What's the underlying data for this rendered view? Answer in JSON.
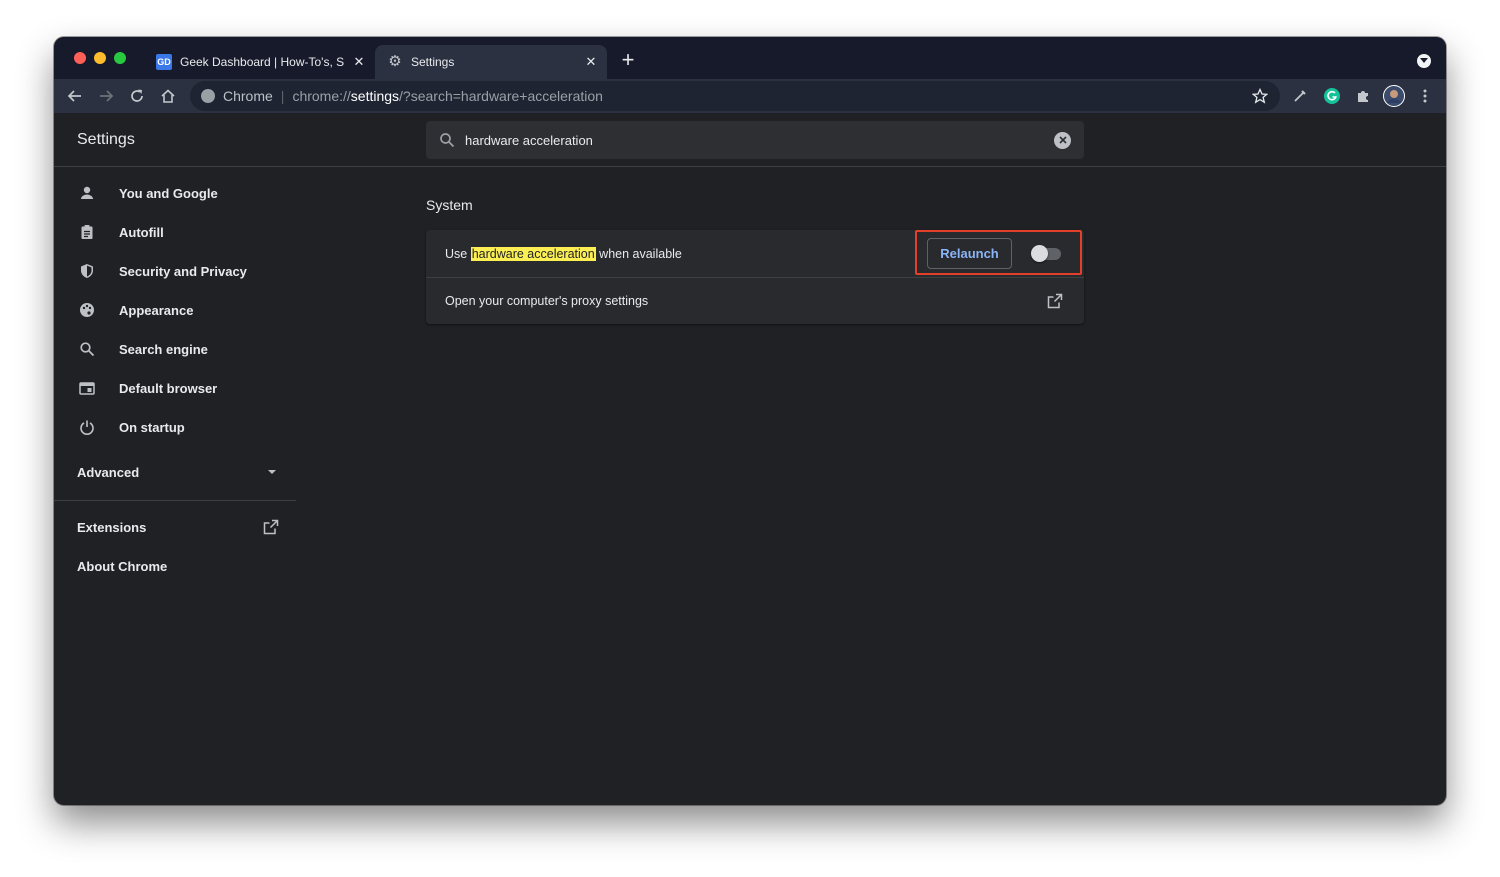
{
  "tabs": [
    {
      "title": "Geek Dashboard | How-To's, S",
      "favicon": "GD",
      "active": false
    },
    {
      "title": "Settings",
      "favicon": "gear-icon",
      "active": true
    }
  ],
  "toolbar": {
    "omnibox": {
      "origin_label": "Chrome",
      "separator": "|",
      "url_scheme": "chrome://",
      "url_host": "settings",
      "url_rest": "/?search=hardware+acceleration"
    }
  },
  "header": {
    "title": "Settings",
    "search_value": "hardware acceleration"
  },
  "sidebar": {
    "items": [
      {
        "label": "You and Google",
        "icon": "person-icon"
      },
      {
        "label": "Autofill",
        "icon": "clipboard-icon"
      },
      {
        "label": "Security and Privacy",
        "icon": "shield-icon"
      },
      {
        "label": "Appearance",
        "icon": "palette-icon"
      },
      {
        "label": "Search engine",
        "icon": "search-icon"
      },
      {
        "label": "Default browser",
        "icon": "browser-icon"
      },
      {
        "label": "On startup",
        "icon": "power-icon"
      }
    ],
    "advanced_label": "Advanced",
    "extensions_label": "Extensions",
    "about_label": "About Chrome"
  },
  "main": {
    "section_title": "System",
    "hw_row": {
      "prefix": "Use ",
      "highlight": "hardware acceleration",
      "suffix": " when available",
      "button_label": "Relaunch",
      "toggle_on": false
    },
    "proxy_row": {
      "label": "Open your computer's proxy settings"
    }
  },
  "colors": {
    "page_bg": "#202124",
    "accent_blue": "#8ab4f8",
    "search_highlight": "#fcef54",
    "annotation_red": "#e2402b"
  }
}
